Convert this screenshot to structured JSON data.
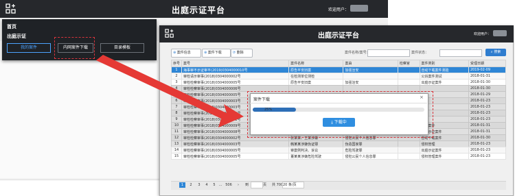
{
  "app": {
    "title": "出庭示证平台",
    "user_label": "欢迎用户："
  },
  "menu": {
    "home_label": "首页",
    "section_label": "出庭示证",
    "buttons": [
      "我的案件",
      "内网案件下载",
      "目录模板"
    ]
  },
  "toolbar": {
    "new_label": "案件信息",
    "open_label": "案件下载",
    "delete_label": "删除",
    "search_label": "案件名称/案号：",
    "status_label": "案件状态：",
    "search_button": "搜索"
  },
  "table": {
    "columns": [
      "序号",
      "案号",
      "案件名称",
      "案由",
      "检察官",
      "案件类别",
      "受理日期"
    ],
    "rows": [
      [
        "1",
        "海事审不示证审平(2019)0304000010号",
        "原告平安旧案",
        "加强治安",
        "",
        "自动下载案件测验",
        "2019-02-09"
      ],
      [
        "2",
        "审检请示审事(2018)0304000002号",
        "在检测单位测检",
        "",
        "",
        "公诉案件测试",
        "2018-01-31"
      ],
      [
        "3",
        "审检检察审事(2018)0304000005号",
        "原告平安旧案",
        "加强治安",
        "",
        "出庭示证案件",
        "2018-01-30"
      ],
      [
        "4",
        "审检检察审事(2018)0304000006号",
        "",
        "",
        "",
        "",
        "2018-01-30"
      ],
      [
        "5",
        "审检检察审事(2018)0304000005号",
        "",
        "",
        "",
        "",
        "2018-01-29"
      ],
      [
        "6",
        "审检检察审事(2018)0304000003号",
        "",
        "",
        "",
        "",
        "2018-01-23"
      ],
      [
        "7",
        "审检检察审事(2018)0304000003号",
        "",
        "",
        "",
        "",
        "2018-01-23"
      ],
      [
        "8",
        "审检检察审事(2018)0304000002号",
        "",
        "",
        "",
        "",
        "2018-01-23"
      ],
      [
        "9",
        "审检检察审事(2018)0304000001号",
        "",
        "",
        "",
        "",
        "2018-01-23"
      ],
      [
        "10",
        "审检检察审事(2018)0304000009号",
        "周某、林某涉嫌诈骗",
        "侵犯公民个人信息罪",
        "",
        "侵权案件",
        "2018-01-31"
      ],
      [
        "11",
        "审检检察审事(2018)0304000008号",
        "张某某侵害",
        "侵犯公民个人信息罪",
        "",
        "出庭示证案件",
        "2018-01-31"
      ],
      [
        "12",
        "审检检察审事(2018)0304000002号",
        "张某某、王某涉嫌",
        "侵犯公民个人信息罪",
        "",
        "自动下载案件",
        "2018-01-30"
      ],
      [
        "13",
        "审检检察审事(2018)0304000003号",
        "韩某某涉嫌伪证罪",
        "伪造国家罪",
        "",
        "侵权管理",
        "2018-01-23"
      ],
      [
        "14",
        "审检检察审事(2018)0304000005号",
        "审案例判决、诉讼",
        "危险驾驶罪",
        "",
        "出庭示证案件",
        "2018-01-23"
      ],
      [
        "15",
        "审检检察审事(2018)0304000005号",
        "董某某涉嫌危险驾驶",
        "侵犯公民个人信息罪",
        "",
        "侵权管理案件",
        "2018-01-23"
      ]
    ]
  },
  "pager": {
    "pages": [
      "1",
      "2",
      "3",
      "4",
      "5",
      "...",
      "506"
    ],
    "next": "›",
    "goto_label": "到",
    "goto_unit": "页",
    "total": "共 700 条",
    "page_size": "20 条/页"
  },
  "modal": {
    "title": "案件下载",
    "close": "×",
    "progress": 0.25,
    "progress_text": "25%",
    "button_label": "下载中"
  },
  "colors": {
    "header": "#26282c",
    "accent": "#2e86d6",
    "highlight": "#d9343c"
  }
}
